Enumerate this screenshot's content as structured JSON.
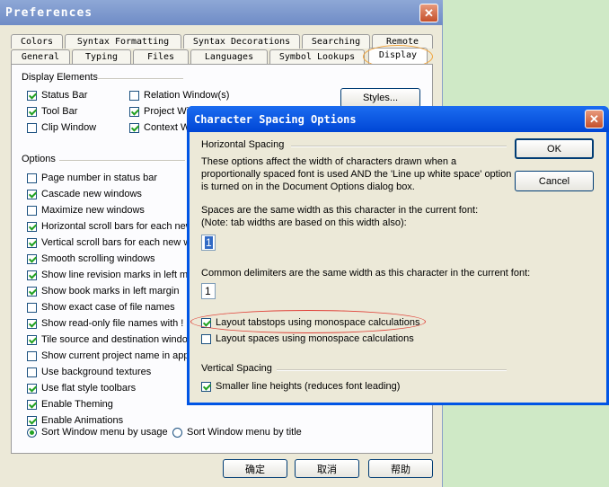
{
  "preferences": {
    "title": "Preferences",
    "tabs_row1": [
      "Colors",
      "Syntax Formatting",
      "Syntax Decorations",
      "Searching",
      "Remote"
    ],
    "tabs_row2": [
      "General",
      "Typing",
      "Files",
      "Languages",
      "Symbol Lookups",
      "Display"
    ],
    "display_elements_title": "Display Elements",
    "display_elements": [
      {
        "label": "Status Bar",
        "checked": true
      },
      {
        "label": "Tool Bar",
        "checked": true
      },
      {
        "label": "Clip Window",
        "checked": false
      },
      {
        "label": "Relation Window(s)",
        "checked": false
      },
      {
        "label": "Project Wi",
        "checked": true
      },
      {
        "label": "Context W",
        "checked": true
      }
    ],
    "styles_button": "Styles...",
    "options_title": "Options",
    "options": [
      {
        "label": "Page number in status bar",
        "checked": false
      },
      {
        "label": "Cascade new windows",
        "checked": true
      },
      {
        "label": "Maximize new windows",
        "checked": false
      },
      {
        "label": "Horizontal scroll bars for each new",
        "checked": true
      },
      {
        "label": "Vertical scroll bars for each new wi",
        "checked": true
      },
      {
        "label": "Smooth scrolling windows",
        "checked": true
      },
      {
        "label": "Show line revision marks in left mar",
        "checked": true
      },
      {
        "label": "Show book marks in left margin",
        "checked": true
      },
      {
        "label": "Show exact case of file names",
        "checked": false
      },
      {
        "label": "Show read-only file names with ! m",
        "checked": true
      },
      {
        "label": "Tile source and destination window",
        "checked": true
      },
      {
        "label": "Show current project name in appli",
        "checked": false
      },
      {
        "label": "Use background textures",
        "checked": false
      },
      {
        "label": "Use flat style toolbars",
        "checked": true
      },
      {
        "label": "Enable Theming",
        "checked": true
      },
      {
        "label": "Enable Animations",
        "checked": true
      }
    ],
    "sort_usage": "Sort Window menu by usage",
    "sort_title": "Sort Window menu by title",
    "ok": "确定",
    "cancel": "取消",
    "help": "帮助"
  },
  "spacing": {
    "title": "Character Spacing Options",
    "horizontal_title": "Horizontal Spacing",
    "desc_line1": "These options affect the width of characters drawn when a",
    "desc_line2": "proportionally spaced font is used AND the 'Line up white space' option",
    "desc_line3": "is turned on in the Document Options dialog box.",
    "spaces_line1": "Spaces are the same width as this character in the current font:",
    "spaces_line2": "(Note: tab widths are based on this width also):",
    "spaces_value": "1",
    "delim_label": "Common delimiters are the same width as this character in the current font:",
    "delim_value": "1",
    "tabstops_label": "Layout tabstops using monospace calculations",
    "tabstops_checked": true,
    "spaces_mono_label": "Layout spaces using monospace calculations",
    "spaces_mono_checked": false,
    "vertical_title": "Vertical Spacing",
    "smaller_label": "Smaller line heights (reduces font leading)",
    "smaller_checked": true,
    "ok": "OK",
    "cancel": "Cancel"
  }
}
